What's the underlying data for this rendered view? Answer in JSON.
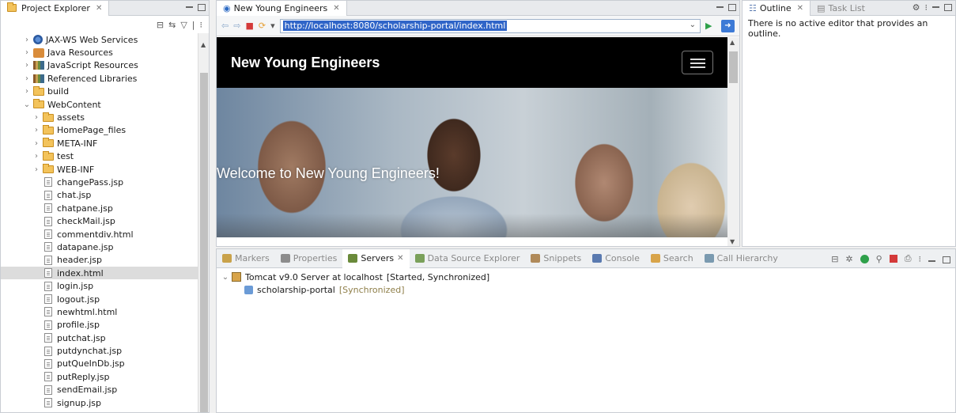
{
  "explorer": {
    "title": "Project Explorer",
    "items": [
      {
        "label": "JAX-WS Web Services",
        "kind": "ws",
        "level": 0,
        "expanded": false
      },
      {
        "label": "Java Resources",
        "kind": "jr",
        "level": 0,
        "expanded": false
      },
      {
        "label": "JavaScript Resources",
        "kind": "lib",
        "level": 0,
        "expanded": false
      },
      {
        "label": "Referenced Libraries",
        "kind": "lib",
        "level": 0,
        "expanded": false
      },
      {
        "label": "build",
        "kind": "folder",
        "level": 0,
        "expanded": false
      },
      {
        "label": "WebContent",
        "kind": "folder",
        "level": 0,
        "expanded": true
      },
      {
        "label": "assets",
        "kind": "folder",
        "level": 1,
        "expanded": false
      },
      {
        "label": "HomePage_files",
        "kind": "folder",
        "level": 1,
        "expanded": false
      },
      {
        "label": "META-INF",
        "kind": "folder",
        "level": 1,
        "expanded": false
      },
      {
        "label": "test",
        "kind": "folder",
        "level": 1,
        "expanded": false
      },
      {
        "label": "WEB-INF",
        "kind": "folder",
        "level": 1,
        "expanded": false
      },
      {
        "label": "changePass.jsp",
        "kind": "file",
        "level": 1
      },
      {
        "label": "chat.jsp",
        "kind": "file",
        "level": 1
      },
      {
        "label": "chatpane.jsp",
        "kind": "file",
        "level": 1
      },
      {
        "label": "checkMail.jsp",
        "kind": "file",
        "level": 1
      },
      {
        "label": "commentdiv.html",
        "kind": "file",
        "level": 1
      },
      {
        "label": "datapane.jsp",
        "kind": "file",
        "level": 1
      },
      {
        "label": "header.jsp",
        "kind": "file",
        "level": 1
      },
      {
        "label": "index.html",
        "kind": "file",
        "level": 1,
        "selected": true
      },
      {
        "label": "login.jsp",
        "kind": "file",
        "level": 1
      },
      {
        "label": "logout.jsp",
        "kind": "file",
        "level": 1
      },
      {
        "label": "newhtml.html",
        "kind": "file",
        "level": 1
      },
      {
        "label": "profile.jsp",
        "kind": "file",
        "level": 1
      },
      {
        "label": "putchat.jsp",
        "kind": "file",
        "level": 1
      },
      {
        "label": "putdynchat.jsp",
        "kind": "file",
        "level": 1
      },
      {
        "label": "putQueInDb.jsp",
        "kind": "file",
        "level": 1
      },
      {
        "label": "putReply.jsp",
        "kind": "file",
        "level": 1
      },
      {
        "label": "sendEmail.jsp",
        "kind": "file",
        "level": 1
      },
      {
        "label": "signup.jsp",
        "kind": "file",
        "level": 1
      }
    ]
  },
  "browser": {
    "tab_title": "New Young Engineers",
    "url": "http://localhost:8080/scholarship-portal/index.html",
    "site": {
      "brand": "New Young Engineers",
      "hero_text": "Welcome to New Young Engineers!"
    }
  },
  "outline": {
    "tab_title": "Outline",
    "tab2_title": "Task List",
    "message": "There is no active editor that provides an outline."
  },
  "servers": {
    "tabs": [
      {
        "label": "Markers",
        "active": false,
        "color": "#c9a24a"
      },
      {
        "label": "Properties",
        "active": false,
        "color": "#8c8c8c"
      },
      {
        "label": "Servers",
        "active": true,
        "color": "#6a8a3a"
      },
      {
        "label": "Data Source Explorer",
        "active": false,
        "color": "#7aa05a"
      },
      {
        "label": "Snippets",
        "active": false,
        "color": "#b08a5a"
      },
      {
        "label": "Console",
        "active": false,
        "color": "#5a7ab0"
      },
      {
        "label": "Search",
        "active": false,
        "color": "#d8a44a"
      },
      {
        "label": "Call Hierarchy",
        "active": false,
        "color": "#7a9ab0"
      }
    ],
    "server_name": "Tomcat v9.0 Server at localhost",
    "server_status": "[Started, Synchronized]",
    "module_name": "scholarship-portal",
    "module_status": "[Synchronized]"
  },
  "colors": {
    "selection": "#3065c8",
    "navbar": "#000000",
    "sync_text": "#8f7f4a"
  }
}
